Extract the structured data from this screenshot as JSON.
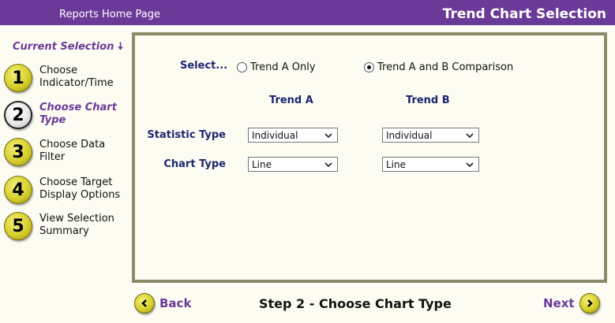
{
  "header": {
    "home_link": "Reports Home Page",
    "title": "Trend Chart Selection"
  },
  "sidebar": {
    "current_selection": "Current Selection",
    "steps": [
      {
        "number": "1",
        "label_line1": "Choose",
        "label_line2": "Indicator/Time"
      },
      {
        "number": "2",
        "label_line1": "Choose Chart",
        "label_line2": "Type",
        "active": true
      },
      {
        "number": "3",
        "label_line1": "Choose Data",
        "label_line2": "Filter"
      },
      {
        "number": "4",
        "label_line1": "Choose Target",
        "label_line2": "Display Options"
      },
      {
        "number": "5",
        "label_line1": "View Selection",
        "label_line2": "Summary"
      }
    ]
  },
  "form": {
    "select_label": "Select...",
    "options": [
      {
        "label": "Trend A Only",
        "checked": false
      },
      {
        "label": "Trend A and B Comparison",
        "checked": true
      }
    ],
    "col_a": "Trend A",
    "col_b": "Trend B",
    "statistic_label": "Statistic Type",
    "chart_type_label": "Chart Type",
    "statistic_a": "Individual",
    "statistic_b": "Individual",
    "chart_a": "Line",
    "chart_b": "Line"
  },
  "footer": {
    "back": "Back",
    "next": "Next",
    "step_title": "Step 2 - Choose Chart Type"
  },
  "colors": {
    "purple": "#6b3a99",
    "navy": "#1b2670",
    "panel_border": "#8b8b6b",
    "bg": "#fdfcf3"
  }
}
